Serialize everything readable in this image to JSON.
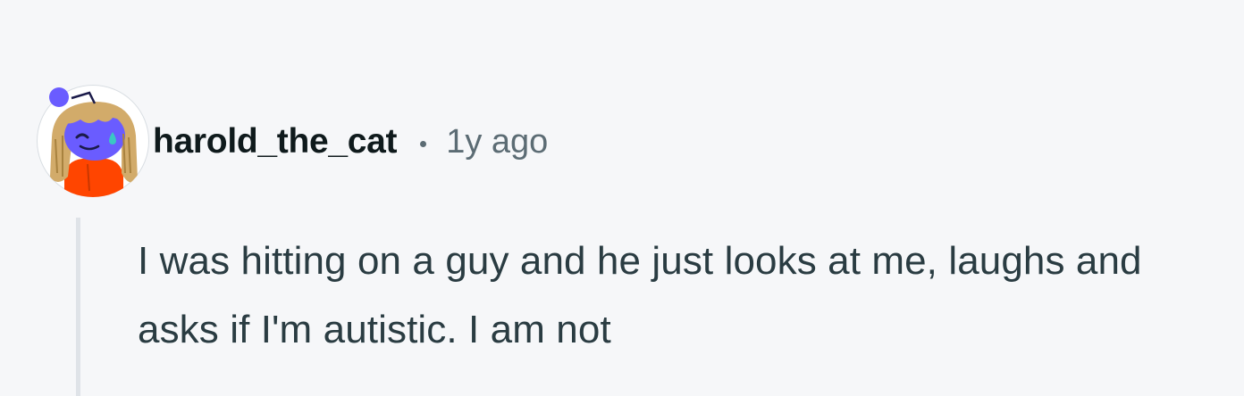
{
  "comment": {
    "author": "harold_the_cat",
    "separator": "•",
    "timestamp": "1y ago",
    "body": "I was hitting on a guy and he just looks at me, laughs and asks if I'm autistic. I am not",
    "avatar_icon": "snoo-avatar-icon"
  },
  "colors": {
    "background": "#f6f7f9",
    "username": "#0f1a1c",
    "meta": "#5c6c74",
    "body": "#2a3c42",
    "thread_line": "#dfe3e8"
  }
}
